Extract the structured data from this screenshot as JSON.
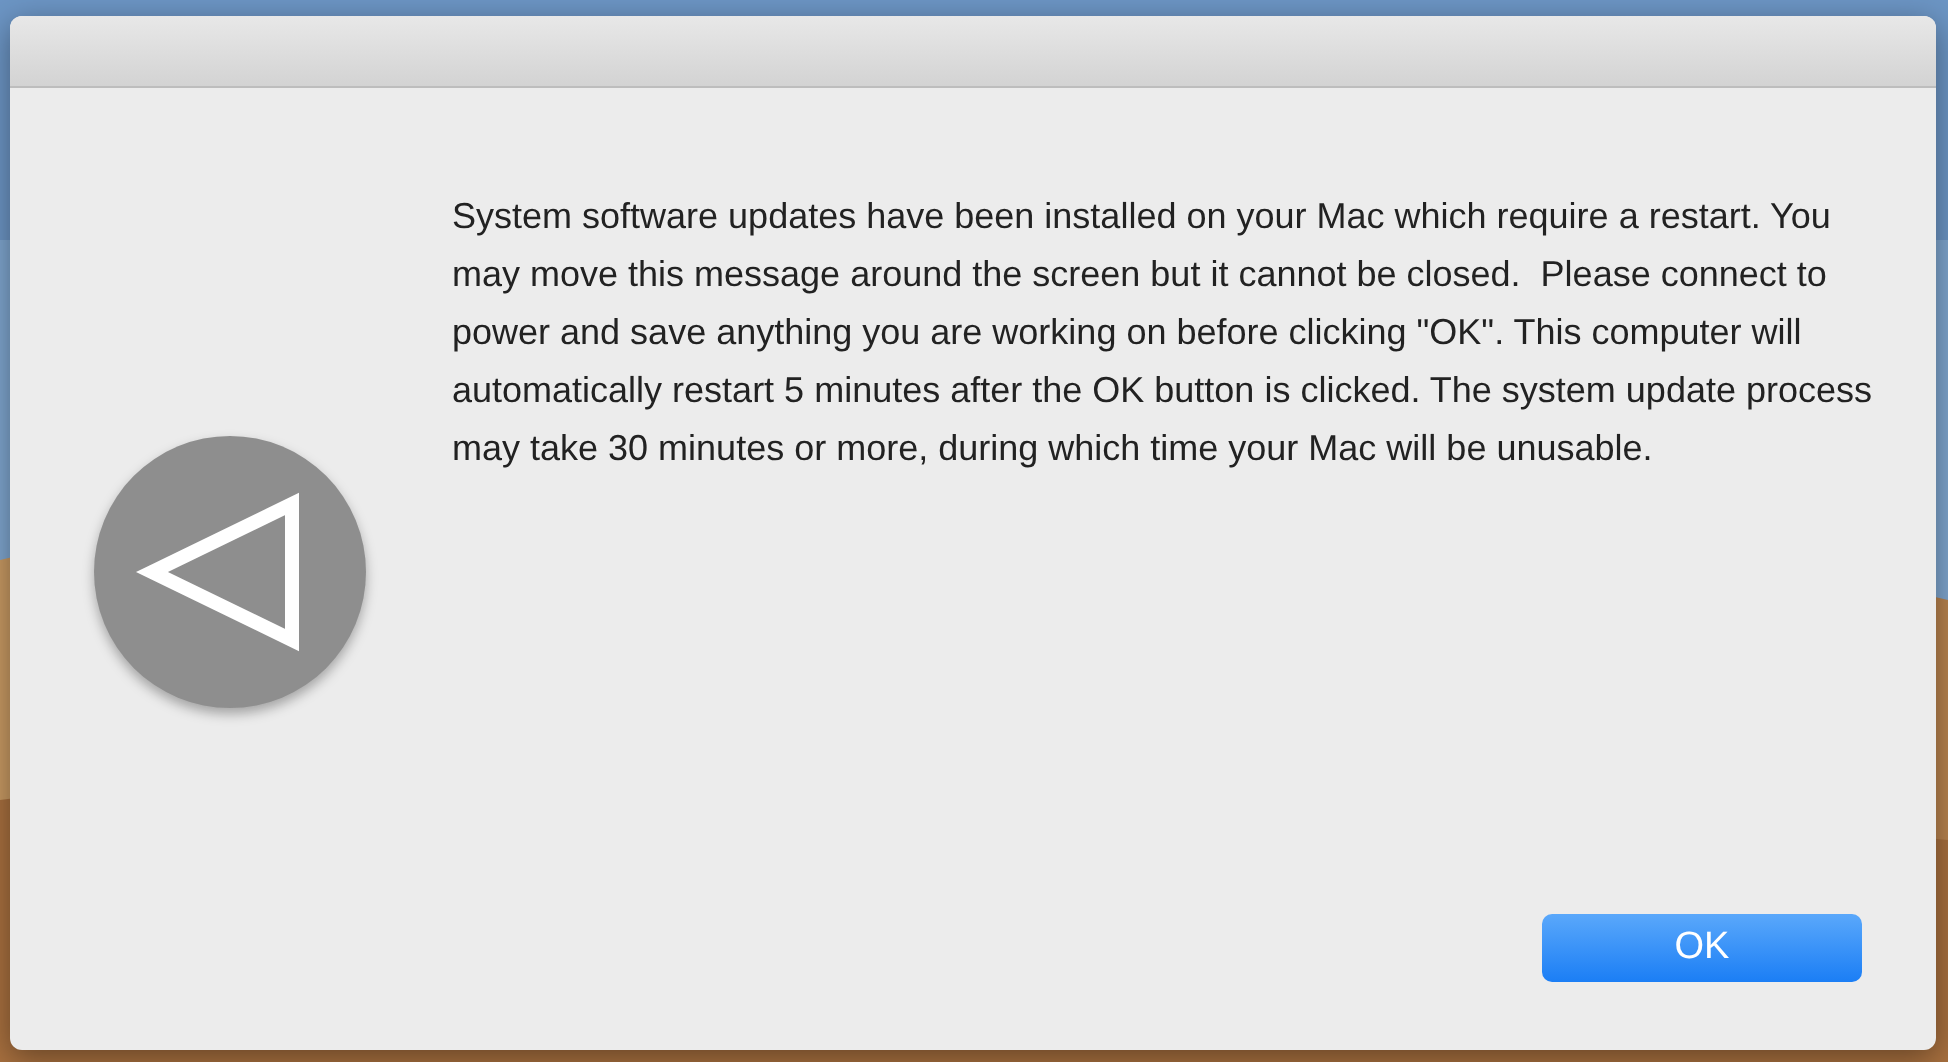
{
  "dialog": {
    "message": "System software updates have been installed on your Mac which require a restart. You may move this message around the screen but it cannot be closed.  Please connect to power and save anything you are working on before clicking \"OK\". This computer will automatically restart 5 minutes after the OK button is clicked. The system update process may take 30 minutes or more, during which time your Mac will be unusable.",
    "button": {
      "label": "OK"
    }
  }
}
